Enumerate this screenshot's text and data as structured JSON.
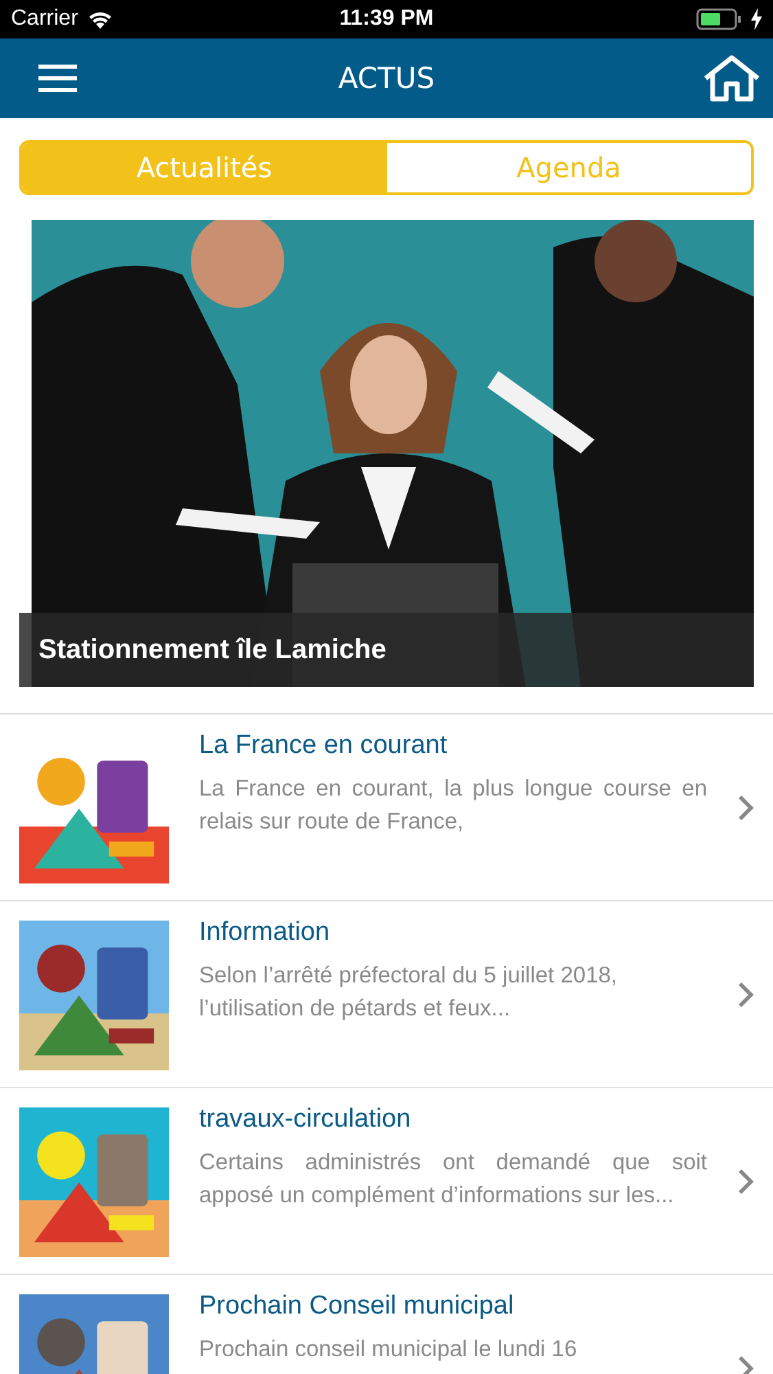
{
  "status_bar": {
    "carrier": "Carrier",
    "time": "11:39 PM"
  },
  "nav": {
    "title": "ACTUS"
  },
  "tabs": [
    {
      "label": "Actualités",
      "selected": true
    },
    {
      "label": "Agenda",
      "selected": false
    }
  ],
  "featured": {
    "caption": "Stationnement île Lamiche"
  },
  "news": [
    {
      "title": "La France en courant",
      "summary": "La France en courant, la plus longue course en relais sur route de France,"
    },
    {
      "title": "Information",
      "summary": "Selon l’arrêté préfectoral du 5 juillet 2018,\nl’utilisation de pétards et feux..."
    },
    {
      "title": "travaux-circulation",
      "summary": "Certains administrés ont demandé que soit apposé un complément d’informations sur les..."
    },
    {
      "title": "Prochain Conseil municipal",
      "summary": "Prochain conseil municipal le lundi 16"
    }
  ]
}
